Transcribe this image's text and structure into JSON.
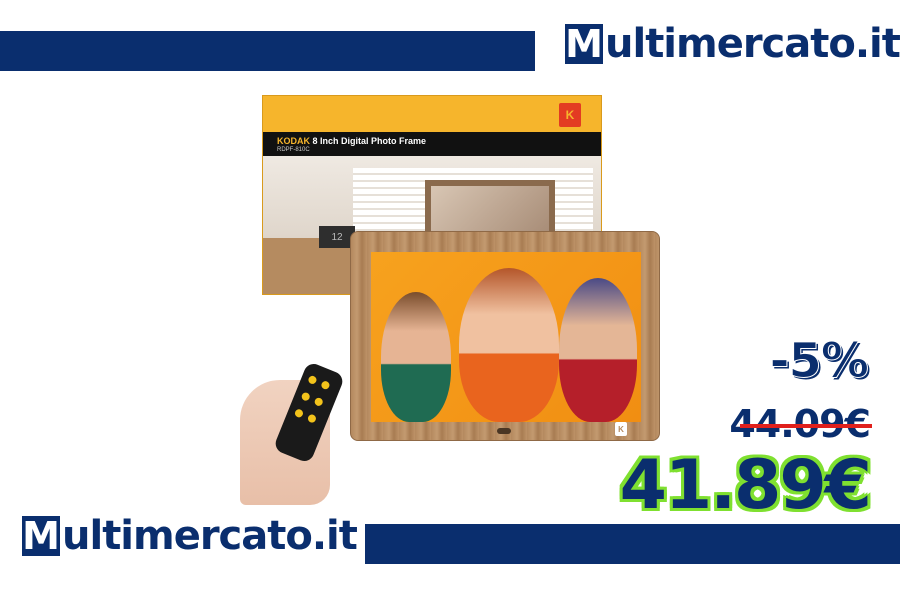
{
  "brand": {
    "logo_letter": "M",
    "logo_rest": "ultimercato.it",
    "color": "#0a2e6e"
  },
  "product": {
    "box_brand": "KODAK",
    "box_title": "8 Inch Digital Photo Frame",
    "box_model": "RDPF-810C",
    "box_badge": "K",
    "clock_text": "12"
  },
  "pricing": {
    "discount": "-5%",
    "old_price": "44.09€",
    "new_price": "41.89€",
    "strike_color": "#e0201c",
    "highlight_color": "#7fe030"
  }
}
